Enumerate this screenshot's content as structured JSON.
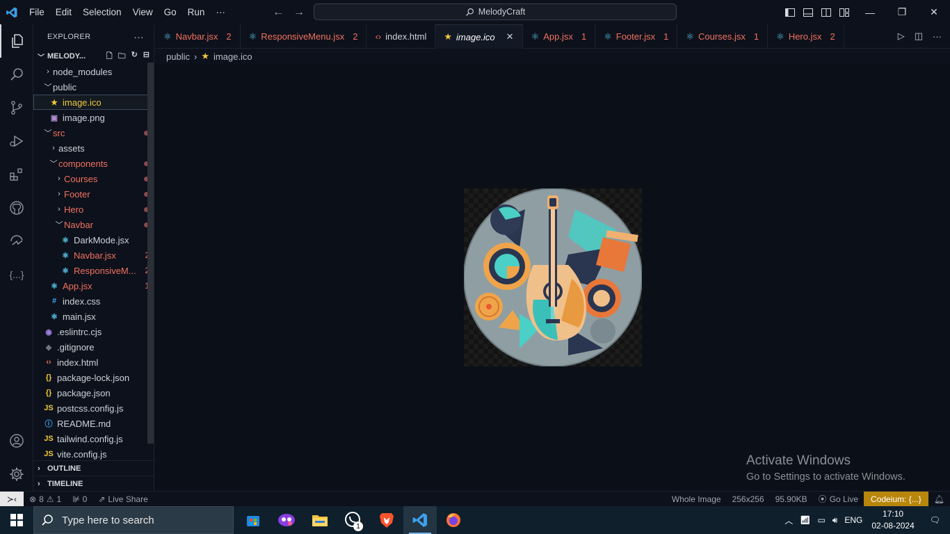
{
  "titlebar": {
    "menu": [
      "File",
      "Edit",
      "Selection",
      "View",
      "Go",
      "Run",
      "···"
    ],
    "command_center": "MelodyCraft"
  },
  "explorer": {
    "title": "EXPLORER",
    "more": "···",
    "project": "MELODY...",
    "items": [
      {
        "label": "node_modules",
        "depth": 1,
        "kind": "folder-closed",
        "color": "#cdd2da"
      },
      {
        "label": "public",
        "depth": 1,
        "kind": "folder-open",
        "color": "#cdd2da"
      },
      {
        "label": "image.ico",
        "depth": 2,
        "kind": "file",
        "icon": "star",
        "color": "#f0c93a",
        "selected": true
      },
      {
        "label": "image.png",
        "depth": 2,
        "kind": "file",
        "icon": "image",
        "color": "#cdd2da"
      },
      {
        "label": "src",
        "depth": 1,
        "kind": "folder-open",
        "color": "#f2715f",
        "dot": true
      },
      {
        "label": "assets",
        "depth": 2,
        "kind": "folder-closed",
        "color": "#cdd2da"
      },
      {
        "label": "components",
        "depth": 2,
        "kind": "folder-open",
        "color": "#f2715f",
        "dot": true
      },
      {
        "label": "Courses",
        "depth": 3,
        "kind": "folder-closed",
        "color": "#f2715f",
        "dot": true
      },
      {
        "label": "Footer",
        "depth": 3,
        "kind": "folder-closed",
        "color": "#f2715f",
        "dot": true
      },
      {
        "label": "Hero",
        "depth": 3,
        "kind": "folder-closed",
        "color": "#f2715f",
        "dot": true
      },
      {
        "label": "Navbar",
        "depth": 3,
        "kind": "folder-open",
        "color": "#f2715f",
        "dot": true
      },
      {
        "label": "DarkMode.jsx",
        "depth": 4,
        "kind": "file",
        "icon": "react",
        "color": "#cdd2da"
      },
      {
        "label": "Navbar.jsx",
        "depth": 4,
        "kind": "file",
        "icon": "react",
        "color": "#f2715f",
        "badge": "2"
      },
      {
        "label": "ResponsiveM...",
        "depth": 4,
        "kind": "file",
        "icon": "react",
        "color": "#f2715f",
        "badge": "2"
      },
      {
        "label": "App.jsx",
        "depth": 2,
        "kind": "file",
        "icon": "react",
        "color": "#f2715f",
        "badge": "1"
      },
      {
        "label": "index.css",
        "depth": 2,
        "kind": "file",
        "icon": "hash",
        "color": "#cdd2da"
      },
      {
        "label": "main.jsx",
        "depth": 2,
        "kind": "file",
        "icon": "react",
        "color": "#cdd2da"
      },
      {
        "label": ".eslintrc.cjs",
        "depth": 1,
        "kind": "file",
        "icon": "eslint",
        "color": "#cdd2da"
      },
      {
        "label": ".gitignore",
        "depth": 1,
        "kind": "file",
        "icon": "git",
        "color": "#cdd2da"
      },
      {
        "label": "index.html",
        "depth": 1,
        "kind": "file",
        "icon": "html",
        "color": "#cdd2da"
      },
      {
        "label": "package-lock.json",
        "depth": 1,
        "kind": "file",
        "icon": "json",
        "color": "#cdd2da"
      },
      {
        "label": "package.json",
        "depth": 1,
        "kind": "file",
        "icon": "json",
        "color": "#cdd2da"
      },
      {
        "label": "postcss.config.js",
        "depth": 1,
        "kind": "file",
        "icon": "js",
        "color": "#cdd2da"
      },
      {
        "label": "README.md",
        "depth": 1,
        "kind": "file",
        "icon": "info",
        "color": "#cdd2da"
      },
      {
        "label": "tailwind.config.js",
        "depth": 1,
        "kind": "file",
        "icon": "js",
        "color": "#cdd2da"
      },
      {
        "label": "vite.config.js",
        "depth": 1,
        "kind": "file",
        "icon": "js",
        "color": "#cdd2da"
      }
    ],
    "outline": "OUTLINE",
    "timeline": "TIMELINE"
  },
  "tabs": [
    {
      "label": "Navbar.jsx",
      "num": "2",
      "icon": "react",
      "color": "#f2715f"
    },
    {
      "label": "ResponsiveMenu.jsx",
      "num": "2",
      "icon": "react",
      "color": "#f2715f"
    },
    {
      "label": "index.html",
      "num": "",
      "icon": "html",
      "color": "#cdd2da"
    },
    {
      "label": "image.ico",
      "num": "",
      "icon": "star",
      "color": "#ffffff",
      "active": true
    },
    {
      "label": "App.jsx",
      "num": "1",
      "icon": "react",
      "color": "#f2715f"
    },
    {
      "label": "Footer.jsx",
      "num": "1",
      "icon": "react",
      "color": "#f2715f"
    },
    {
      "label": "Courses.jsx",
      "num": "1",
      "icon": "react",
      "color": "#f2715f"
    },
    {
      "label": "Hero.jsx",
      "num": "2",
      "icon": "react",
      "color": "#f2715f"
    }
  ],
  "breadcrumb": {
    "folder": "public",
    "file": "image.ico"
  },
  "watermark": {
    "title": "Activate Windows",
    "subtitle": "Go to Settings to activate Windows."
  },
  "statusbar": {
    "errors": "8",
    "warnings": "1",
    "ports": "0",
    "live_share": "Live Share",
    "zoom": "Whole Image",
    "dimensions": "256x256",
    "size": "95.90KB",
    "go_live": "Go Live",
    "codeium": "Codeium: {...}"
  },
  "taskbar": {
    "search_placeholder": "Type here to search",
    "whatsapp_badge": "1",
    "lang": "ENG",
    "time": "17:10",
    "date": "02-08-2024"
  },
  "colors": {
    "accent": "#007acc",
    "modified": "#f2715f",
    "codeium": "#b8860b"
  }
}
